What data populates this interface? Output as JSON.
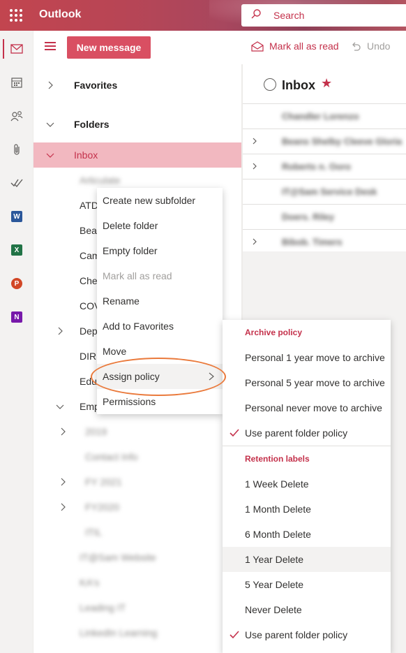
{
  "header": {
    "app_title": "Outlook",
    "search_placeholder": "Search"
  },
  "rail": {
    "items": [
      "mail-icon",
      "calendar-icon",
      "people-icon",
      "attachment-icon",
      "todo-icon",
      "word-icon",
      "excel-icon",
      "powerpoint-icon",
      "onenote-icon"
    ],
    "office_letters": {
      "word": "W",
      "excel": "X",
      "powerpoint": "P",
      "onenote": "N"
    }
  },
  "commandbar": {
    "new_message": "New message",
    "mark_all_read": "Mark all as read",
    "undo": "Undo"
  },
  "folders": {
    "favorites": "Favorites",
    "folders": "Folders",
    "inbox": "Inbox",
    "subfolders": [
      {
        "label": "Articulate",
        "blurred": true
      },
      {
        "label": "ATD",
        "blurred": false
      },
      {
        "label": "Bear",
        "blurred": false
      },
      {
        "label": "Cam",
        "blurred": false
      },
      {
        "label": "Che",
        "blurred": false
      },
      {
        "label": "COV",
        "blurred": false
      },
      {
        "label": "Dep",
        "blurred": false
      },
      {
        "label": "DIR",
        "blurred": false
      },
      {
        "label": "Edu",
        "blurred": false
      },
      {
        "label": "Emp",
        "blurred": false
      }
    ],
    "nested": [
      "2019",
      "Contact Info",
      "FY 2021",
      "FY2020",
      "ITIL"
    ],
    "more": [
      "IT@Sam Website",
      "KA's",
      "Leading IT",
      "LinkedIn Learning"
    ]
  },
  "list": {
    "title": "Inbox",
    "senders": [
      "Chandler Lorenzo",
      "Beans Shelby Cleeve Gloria",
      "Roberts n. Ooro",
      "IT@Sam Service Desk",
      "Doers. Riley",
      "Bibob. Timers"
    ]
  },
  "context_menu": {
    "items": [
      "Create new subfolder",
      "Delete folder",
      "Empty folder",
      "Mark all as read",
      "Rename",
      "Add to Favorites",
      "Move",
      "Assign policy",
      "Permissions"
    ]
  },
  "policy_menu": {
    "archive_header": "Archive policy",
    "archive_items": [
      "Personal 1 year move to archive",
      "Personal 5 year move to archive",
      "Personal never move to archive",
      "Use parent folder policy"
    ],
    "retention_header": "Retention labels",
    "retention_items": [
      "1 Week Delete",
      "1 Month Delete",
      "6 Month Delete",
      "1 Year Delete",
      "5 Year Delete",
      "Never Delete",
      "Use parent folder policy"
    ]
  },
  "colors": {
    "accent": "#c4314b",
    "button": "#d94f62",
    "selected_folder": "#f2b8c0",
    "highlight_ring": "#ea7a3c"
  }
}
